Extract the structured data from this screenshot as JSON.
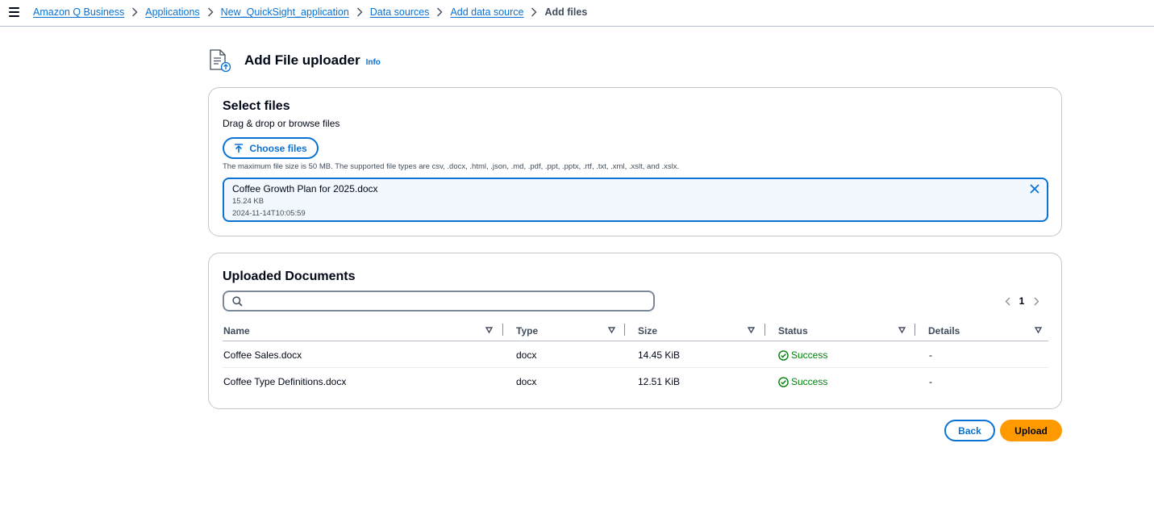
{
  "breadcrumb": {
    "items": [
      "Amazon Q Business",
      "Applications",
      "New_QuickSight_application",
      "Data sources",
      "Add data source"
    ],
    "current": "Add files"
  },
  "header": {
    "title": "Add File uploader",
    "info": "Info",
    "icon": "document-upload-icon"
  },
  "select_files": {
    "title": "Select files",
    "description": "Drag & drop or browse files",
    "choose_label": "Choose files",
    "constraint": "The maximum file size is 50 MB. The supported file types are csv, .docx, .html, .json, .md, .pdf, .ppt, .pptx, .rtf, .txt, .xml, .xslt, and .xslx.",
    "file": {
      "name": "Coffee Growth Plan for 2025.docx",
      "size": "15.24 KB",
      "modified": "2024-11-14T10:05:59"
    }
  },
  "uploaded_documents": {
    "title": "Uploaded Documents",
    "search_placeholder": "",
    "page": "1",
    "columns": [
      "Name",
      "Type",
      "Size",
      "Status",
      "Details"
    ],
    "rows": [
      {
        "name": "Coffee Sales.docx",
        "type": "docx",
        "size": "14.45 KiB",
        "status": "Success",
        "details": "-"
      },
      {
        "name": "Coffee Type Definitions.docx",
        "type": "docx",
        "size": "12.51 KiB",
        "status": "Success",
        "details": "-"
      }
    ]
  },
  "footer": {
    "back_label": "Back",
    "upload_label": "Upload"
  },
  "colors": {
    "link": "#0972d3",
    "primary": "#ff9900",
    "success": "#037f0c",
    "text": "#000716"
  }
}
